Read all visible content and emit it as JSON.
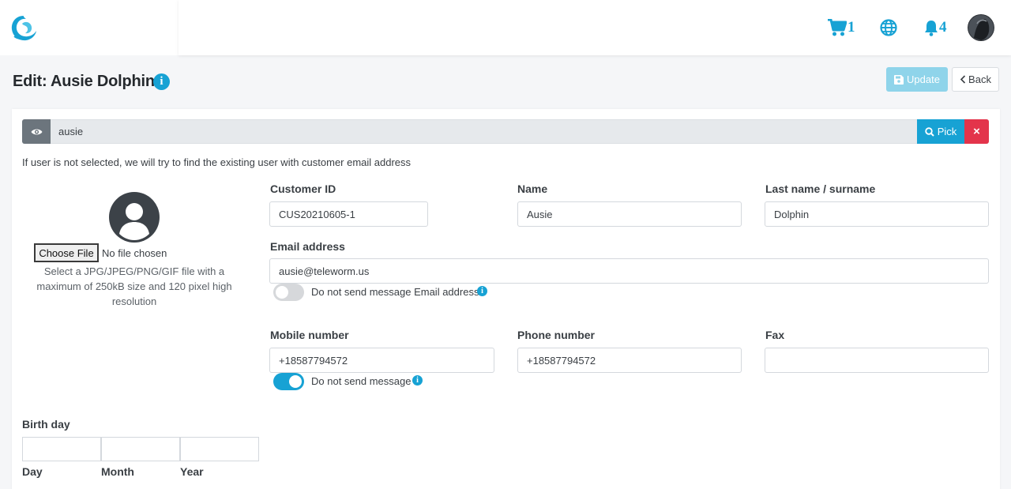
{
  "colors": {
    "accent": "#17a2d4",
    "danger": "#e3344b",
    "muted": "#6c757d",
    "update_disabled": "#8fd4ea"
  },
  "topbar": {
    "cart_count": "1",
    "notifications_count": "4",
    "icons": [
      "logo-icon",
      "cart-icon",
      "globe-icon",
      "bell-icon",
      "user-avatar"
    ]
  },
  "page": {
    "title": "Edit: Ausie Dolphin",
    "update_label": "Update",
    "back_label": "Back"
  },
  "user_select": {
    "value": "ausie",
    "pick_label": "Pick",
    "clear_label": "×",
    "helper": "If user is not selected, we will try to find the existing user with customer email address"
  },
  "photo": {
    "choose_label": "Choose File",
    "no_file": "No file chosen",
    "hint": "Select a JPG/JPEG/PNG/GIF file with a maximum of 250kB size and 120 pixel high resolution"
  },
  "form": {
    "customer_id": {
      "label": "Customer ID",
      "value": "CUS20210605-1"
    },
    "name": {
      "label": "Name",
      "value": "Ausie"
    },
    "last_name": {
      "label": "Last name / surname",
      "value": "Dolphin"
    },
    "email": {
      "label": "Email address",
      "value": "ausie@teleworm.us",
      "toggle_label": "Do not send message Email address",
      "toggle_on": false
    },
    "mobile": {
      "label": "Mobile number",
      "value": "+18587794572",
      "toggle_label": "Do not send message",
      "toggle_on": true
    },
    "phone": {
      "label": "Phone number",
      "value": "+18587794572"
    },
    "fax": {
      "label": "Fax",
      "value": ""
    },
    "birthday": {
      "label": "Birth day",
      "day_label": "Day",
      "month_label": "Month",
      "year_label": "Year"
    }
  }
}
